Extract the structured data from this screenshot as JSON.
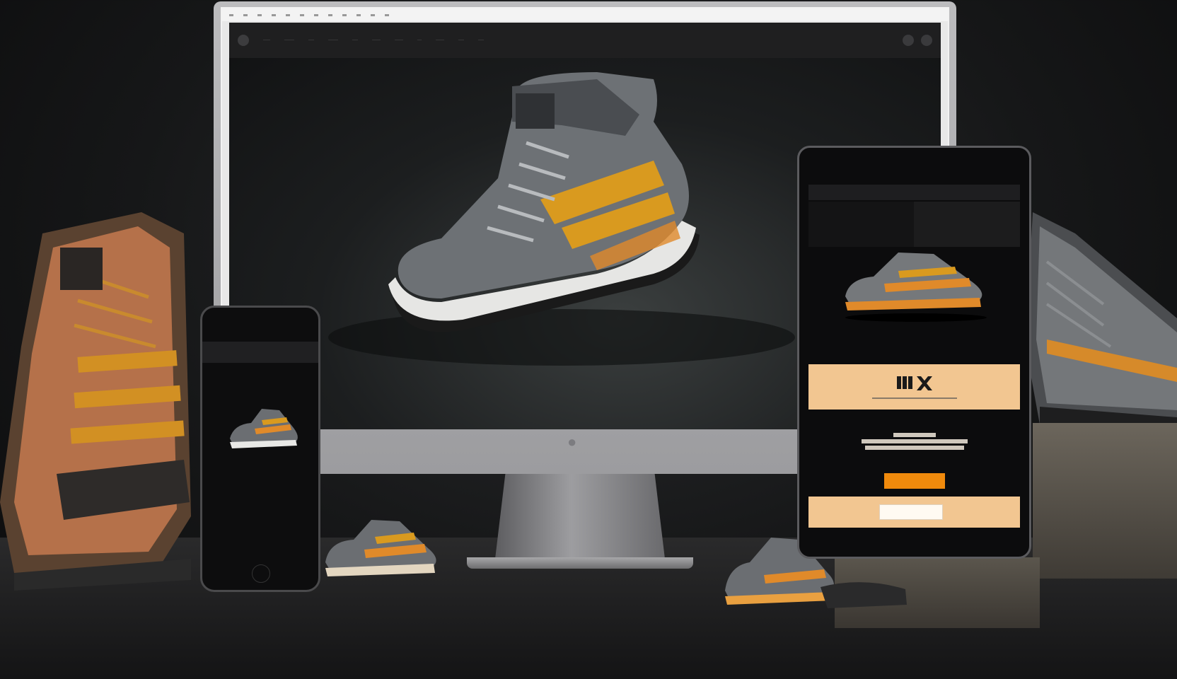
{
  "scene": {
    "description_free": true
  },
  "monitor": {
    "browser_ticks": 22,
    "nav_links": [
      "·····",
      "·······",
      "····",
      "·······",
      "····",
      "······",
      "······",
      "···",
      "······",
      "····",
      "····"
    ],
    "apple_glyph": ""
  },
  "phone": {
    "caption": "",
    "header_text": ""
  },
  "tablet": {
    "brand": "",
    "headline": "",
    "cta_label": ""
  },
  "palette": {
    "accent_orange": "#f08a0c",
    "band_peach": "#f2c691",
    "dark_bg": "#0c0c0d"
  }
}
